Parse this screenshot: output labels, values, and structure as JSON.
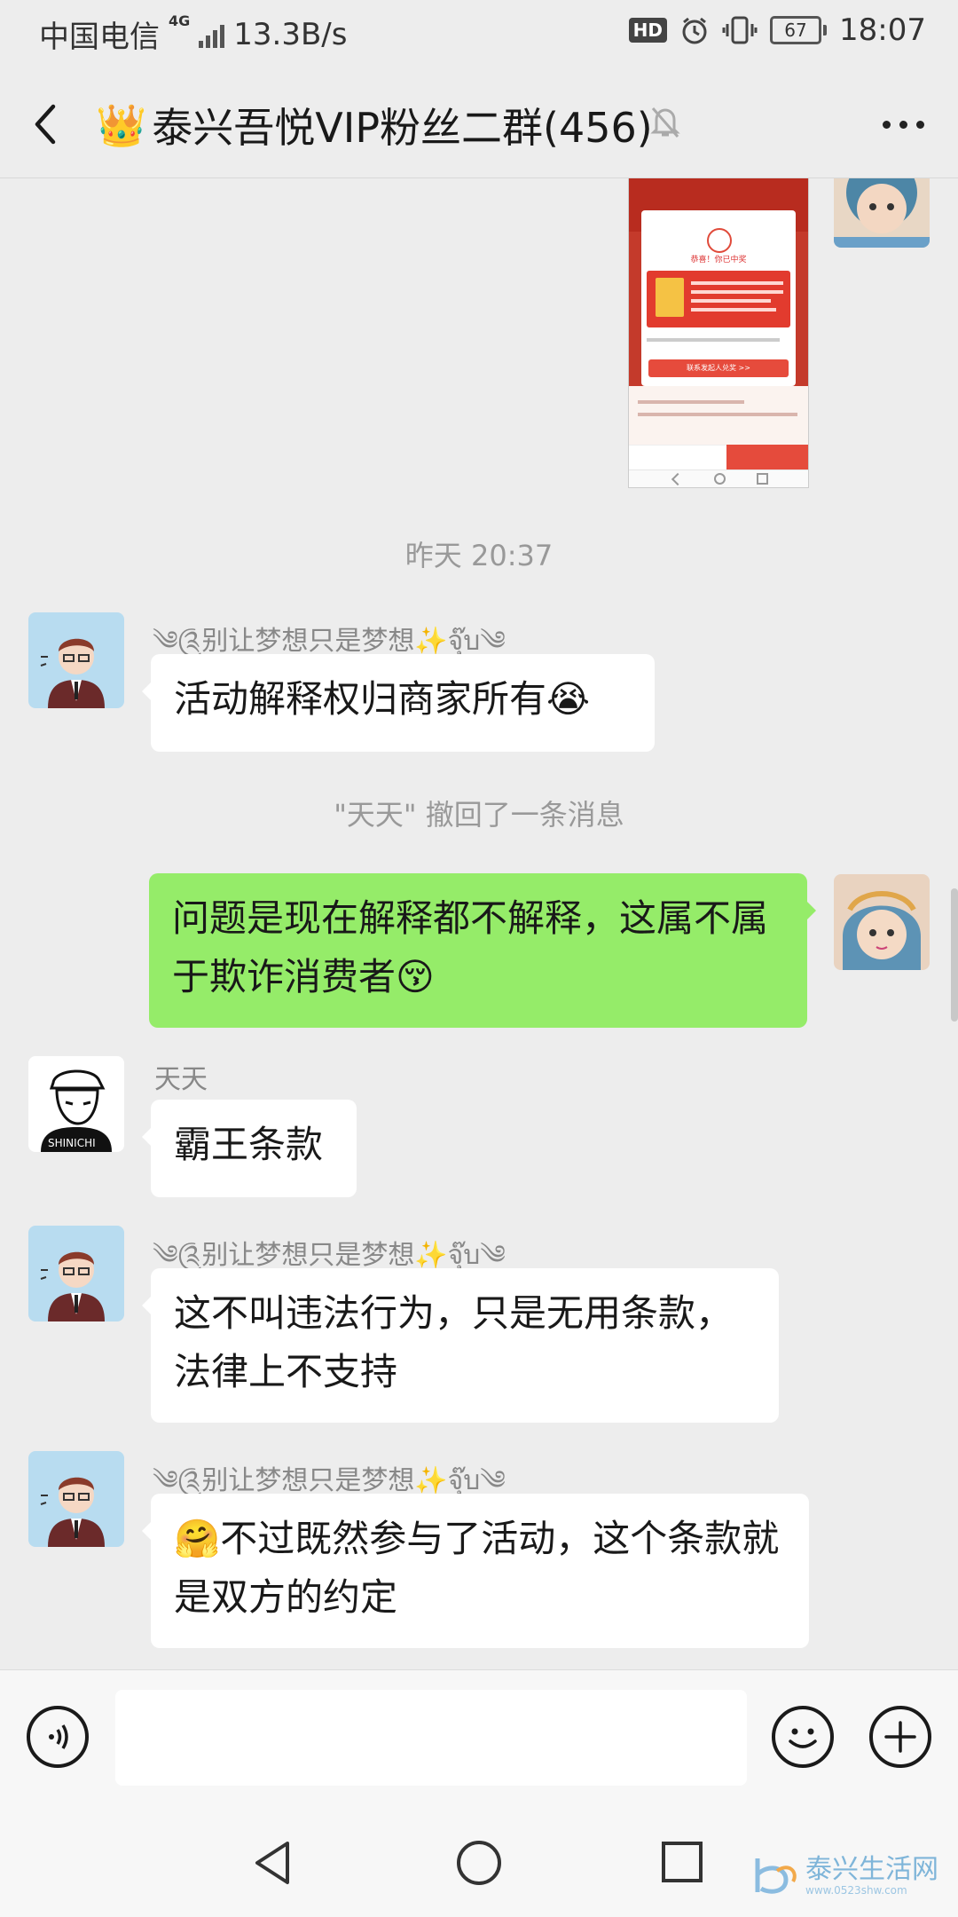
{
  "status_bar": {
    "carrier": "中国电信",
    "network": "4G",
    "speed": "13.3B/s",
    "hd": "HD",
    "battery": "67",
    "time": "18:07"
  },
  "header": {
    "crown_emoji": "👑",
    "title": "泰兴吾悦VIP粉丝二群(456)"
  },
  "chat": {
    "screenshot_preview": {
      "congrats": "恭喜！你已中奖",
      "button": "联系发起人兑奖 >>"
    },
    "timestamp": "昨天 20:37",
    "recall_notice": "\"天天\" 撤回了一条消息",
    "messages": [
      {
        "sender": "༄༊别让梦想只是梦想✨จุ๊บ༄",
        "text": "活动解释权归商家所有",
        "emoji": "😭"
      },
      {
        "sender": "",
        "text": "问题是现在解释都不解释，这属不属于欺诈消费者",
        "emoji": "😚"
      },
      {
        "sender": "天天",
        "text": "霸王条款",
        "emoji": ""
      },
      {
        "sender": "༄༊别让梦想只是梦想✨จุ๊บ༄",
        "text": "这不叫违法行为，只是无用条款，法律上不支持",
        "emoji": ""
      },
      {
        "sender": "༄༊别让梦想只是梦想✨จุ๊บ༄",
        "text": "不过既然参与了活动，这个条款就是双方的约定",
        "emoji": "🤗"
      }
    ]
  },
  "watermark": {
    "title": "泰兴生活网",
    "url": "www.0523shw.com"
  }
}
